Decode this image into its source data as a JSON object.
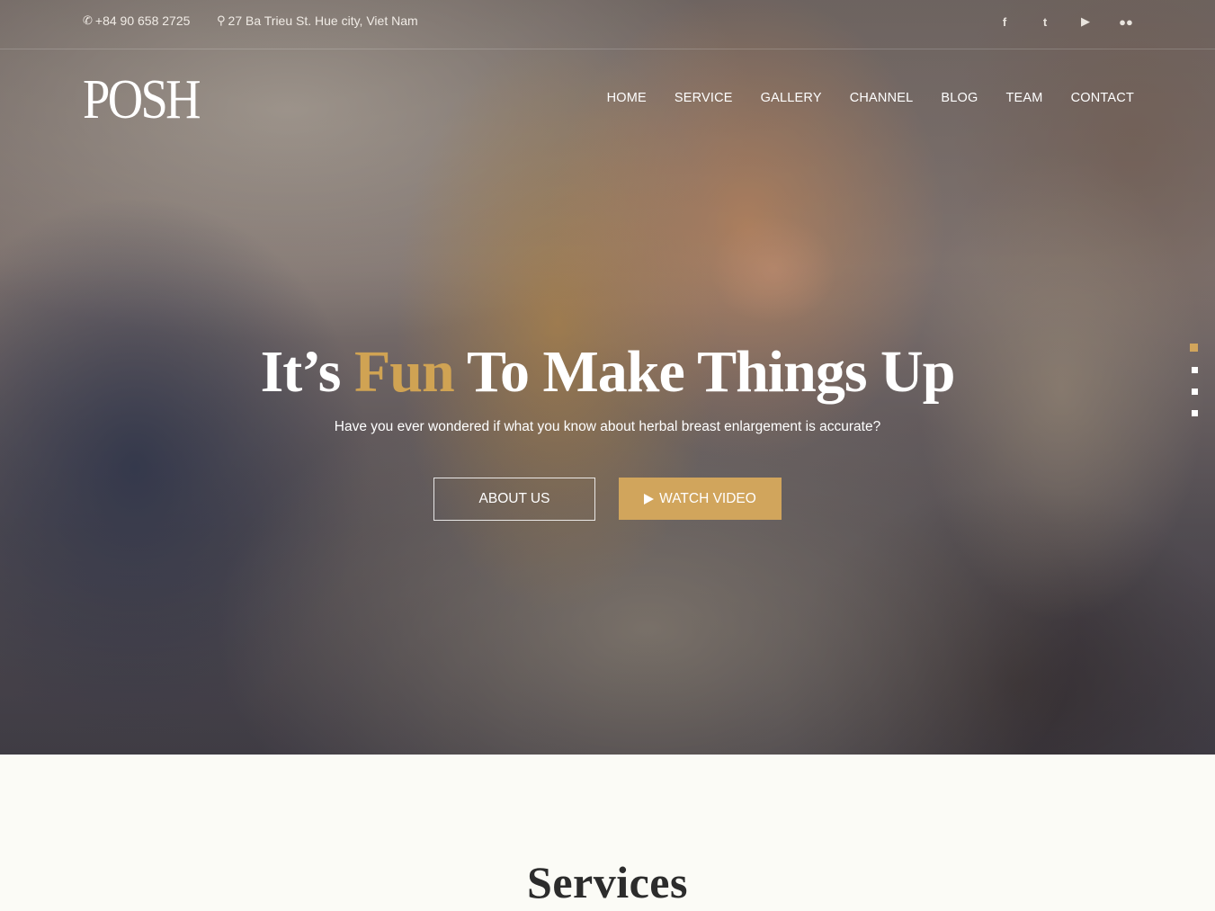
{
  "topbar": {
    "phone": "+84 90 658 2725",
    "address": "27 Ba Trieu St. Hue city, Viet Nam",
    "social": [
      {
        "icon": "facebook-icon",
        "glyph": "f"
      },
      {
        "icon": "twitter-icon",
        "glyph": "t"
      },
      {
        "icon": "youtube-icon",
        "glyph": "▶"
      },
      {
        "icon": "flickr-icon",
        "glyph": "●●"
      }
    ]
  },
  "header": {
    "logo": "POSH",
    "nav": [
      "HOME",
      "SERVICE",
      "GALLERY",
      "CHANNEL",
      "BLOG",
      "TEAM",
      "CONTACT"
    ]
  },
  "hero": {
    "headline_pre": "It’s",
    "headline_accent": "Fun",
    "headline_post": "To Make Things Up",
    "subheadline": "Have you ever wondered if what you know about herbal breast enlargement is accurate?",
    "about_button": "ABOUT US",
    "video_button": "WATCH VIDEO",
    "slide_count": 4,
    "active_slide": 1
  },
  "services": {
    "title": "Services"
  },
  "colors": {
    "accent": "#d1a55c",
    "section_bg": "#fbfbf6"
  }
}
